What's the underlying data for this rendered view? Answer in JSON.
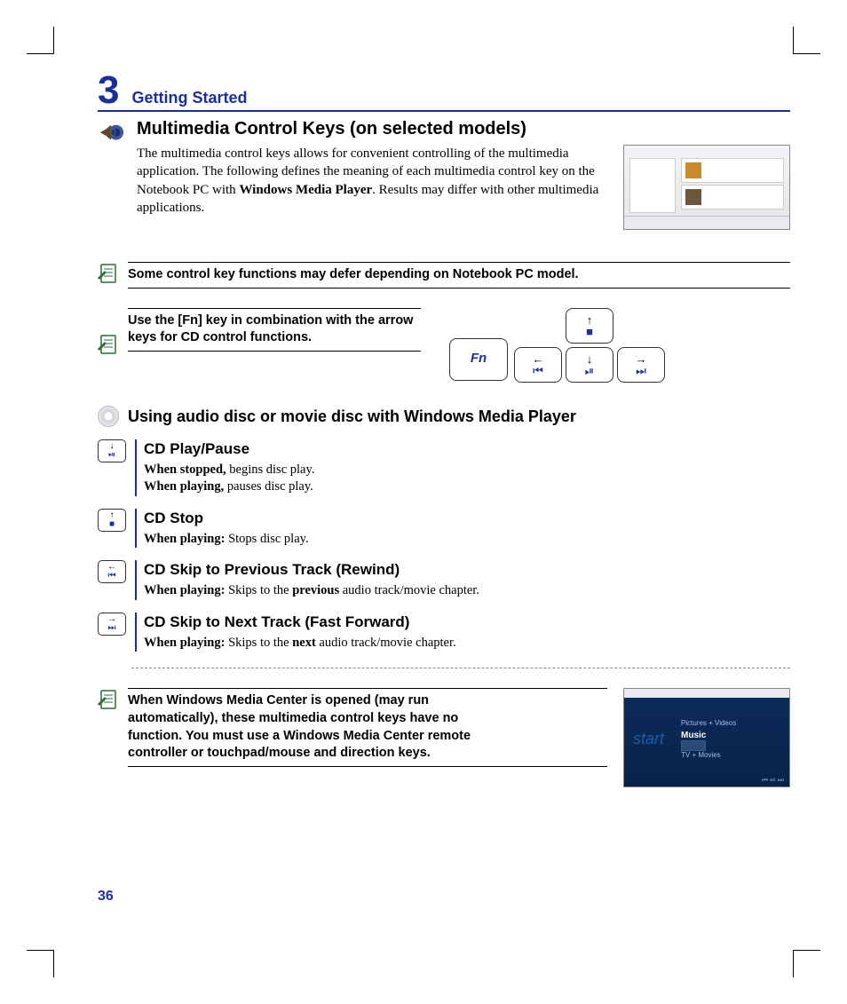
{
  "chapter": {
    "number": "3",
    "title": "Getting Started"
  },
  "section": {
    "title": "Multimedia Control Keys (on selected models)",
    "intro_pre": "The multimedia control keys allows for convenient controlling of the multimedia application. The following defines the meaning of each multimedia control key on the Notebook PC with ",
    "intro_bold": "Windows Media Player",
    "intro_post": ". Results may differ with other multimedia applications."
  },
  "notes": {
    "defer": "Some control key functions may defer depending on Notebook PC model.",
    "fn": "Use the [Fn] key in combination with the arrow keys for CD control functions.",
    "wmc": "When Windows Media Center is opened (may run automatically), these multimedia control keys have no function. You must use a Windows Media Center remote controller or touchpad/mouse and direction keys."
  },
  "keys": {
    "fn_label": "Fn",
    "up": {
      "arrow": "↑",
      "icon": "■"
    },
    "left": {
      "arrow": "←",
      "icon": "⏮"
    },
    "down": {
      "arrow": "↓",
      "icon": "⏯"
    },
    "right": {
      "arrow": "→",
      "icon": "⏭"
    }
  },
  "subheading": "Using audio disc or movie disc with Windows Media Player",
  "controls": [
    {
      "id": "play-pause",
      "mini": {
        "arrow": "↓",
        "icon": "⏯"
      },
      "title": "CD Play/Pause",
      "lines": [
        {
          "b": "When stopped,",
          "t": " begins disc play."
        },
        {
          "b": "When playing,",
          "t": " pauses disc play."
        }
      ]
    },
    {
      "id": "stop",
      "mini": {
        "arrow": "↑",
        "icon": "■"
      },
      "title": "CD Stop",
      "lines": [
        {
          "b": "When playing:",
          "t": " Stops disc play."
        }
      ]
    },
    {
      "id": "prev",
      "mini": {
        "arrow": "←",
        "icon": "⏮"
      },
      "title": "CD Skip to Previous Track (Rewind)",
      "lines": [
        {
          "b": "When playing:",
          "t": " Skips to the ",
          "b2": "previous",
          "t2": " audio track/movie chapter."
        }
      ]
    },
    {
      "id": "next",
      "mini": {
        "arrow": "→",
        "icon": "⏭"
      },
      "title": "CD Skip to Next Track (Fast Forward)",
      "lines": [
        {
          "b": "When playing:",
          "t": " Skips to the ",
          "b2": "next",
          "t2": " audio track/movie chapter."
        }
      ]
    }
  ],
  "wmc_shot": {
    "start": "start",
    "l1": "Pictures + Videos",
    "l2": "Music",
    "l3": "TV + Movies",
    "controls_hint": "⏮  ⏯  ⏭"
  },
  "page_number": "36"
}
